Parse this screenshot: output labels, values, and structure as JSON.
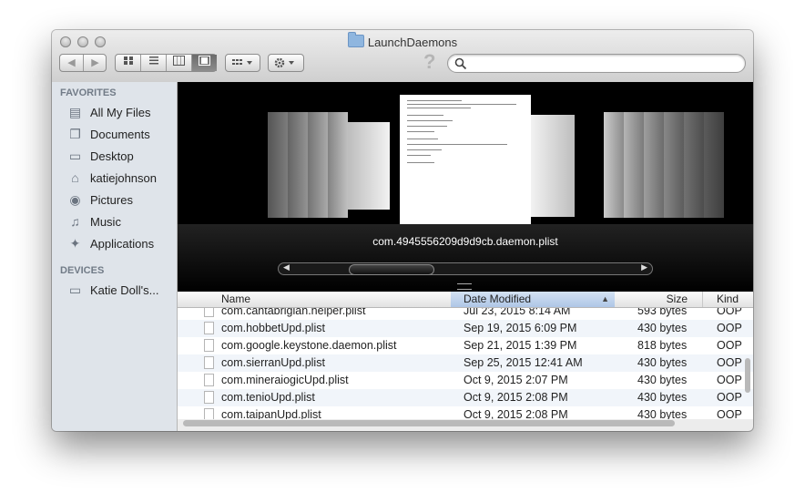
{
  "window": {
    "title": "LaunchDaemons"
  },
  "toolbar": {
    "back": "◀",
    "forward": "▶",
    "help": "?"
  },
  "sidebar": {
    "favorites_heading": "FAVORITES",
    "favorites": [
      {
        "label": "All My Files",
        "icon": "all-files-icon"
      },
      {
        "label": "Documents",
        "icon": "documents-icon"
      },
      {
        "label": "Desktop",
        "icon": "desktop-icon"
      },
      {
        "label": "katiejohnson",
        "icon": "home-icon"
      },
      {
        "label": "Pictures",
        "icon": "camera-icon"
      },
      {
        "label": "Music",
        "icon": "music-icon"
      },
      {
        "label": "Applications",
        "icon": "applications-icon"
      }
    ],
    "devices_heading": "DEVICES",
    "devices": [
      {
        "label": "Katie Doll's...",
        "icon": "computer-icon"
      }
    ]
  },
  "coverflow": {
    "selected_label": "com.4945556209d9d9cb.daemon.plist"
  },
  "columns": {
    "name": "Name",
    "date": "Date Modified",
    "size": "Size",
    "kind": "Kind"
  },
  "files": [
    {
      "name": "com.cantabrigian.helper.plist",
      "date": "Jul 23, 2015 8:14 AM",
      "size": "593 bytes",
      "kind": "OOP"
    },
    {
      "name": "com.hobbetUpd.plist",
      "date": "Sep 19, 2015 6:09 PM",
      "size": "430 bytes",
      "kind": "OOP"
    },
    {
      "name": "com.google.keystone.daemon.plist",
      "date": "Sep 21, 2015 1:39 PM",
      "size": "818 bytes",
      "kind": "OOP"
    },
    {
      "name": "com.sierranUpd.plist",
      "date": "Sep 25, 2015 12:41 AM",
      "size": "430 bytes",
      "kind": "OOP"
    },
    {
      "name": "com.mineraiogicUpd.plist",
      "date": "Oct 9, 2015 2:07 PM",
      "size": "430 bytes",
      "kind": "OOP"
    },
    {
      "name": "com.tenioUpd.plist",
      "date": "Oct 9, 2015 2:08 PM",
      "size": "430 bytes",
      "kind": "OOP"
    },
    {
      "name": "com.taipanUpd.plist",
      "date": "Oct 9, 2015 2:08 PM",
      "size": "430 bytes",
      "kind": "OOP"
    }
  ]
}
